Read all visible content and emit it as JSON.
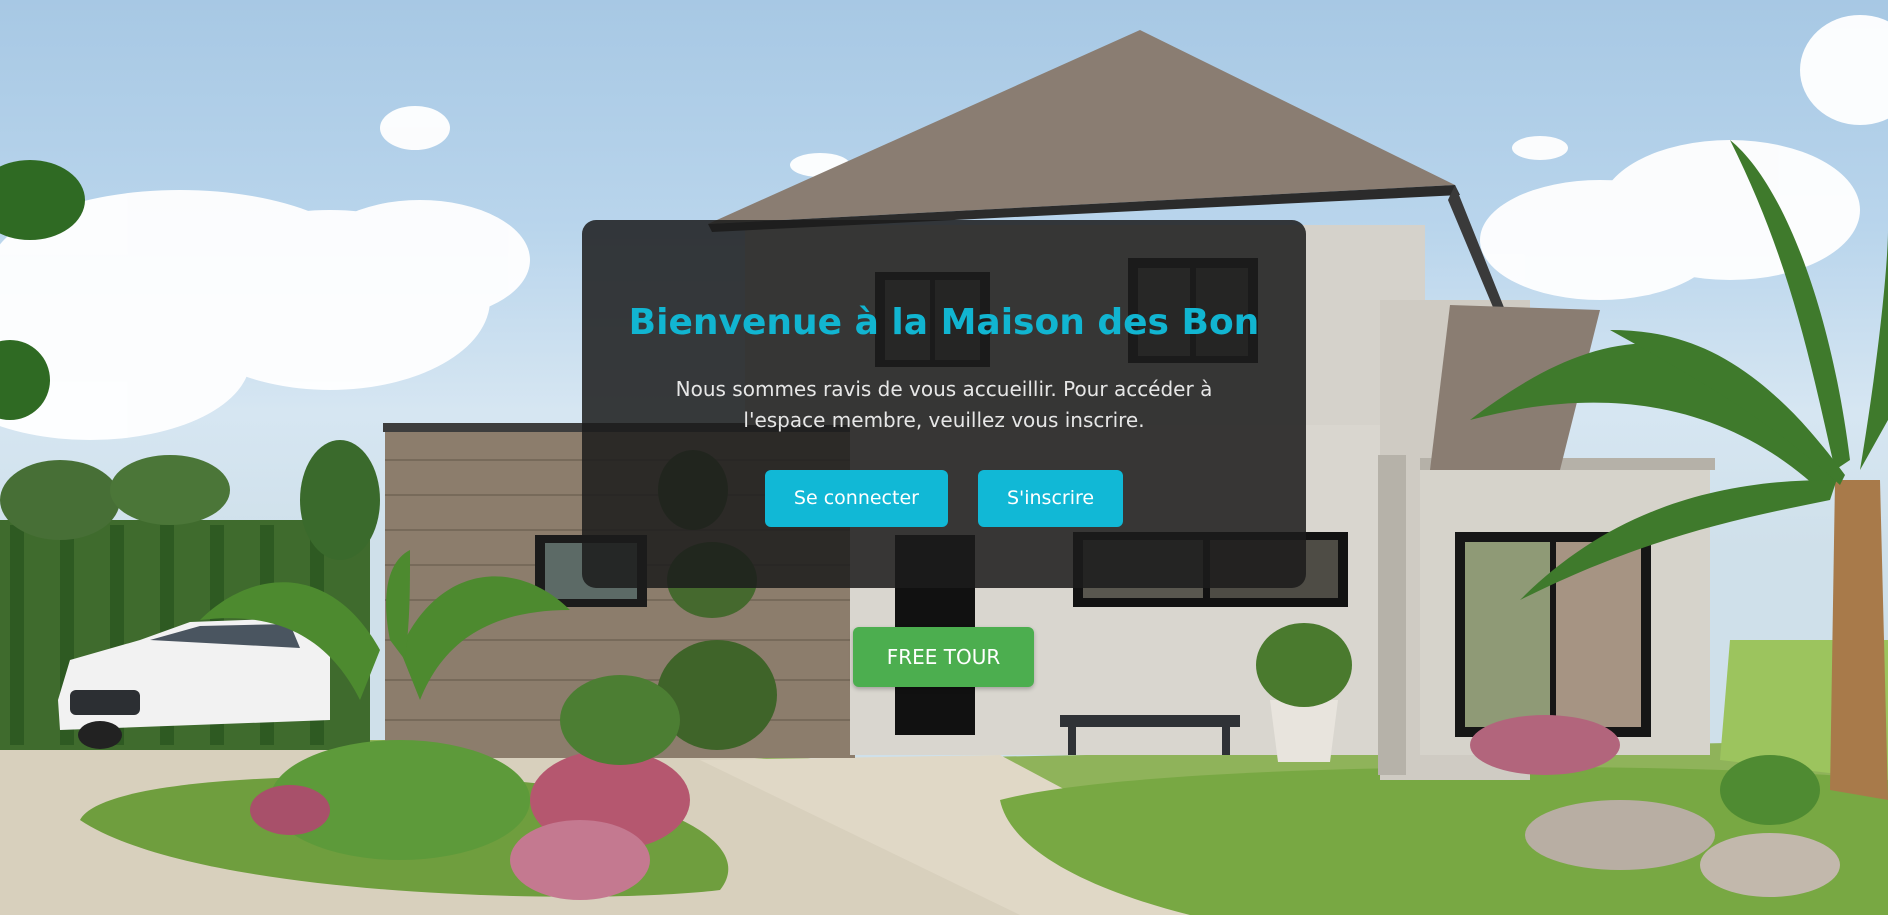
{
  "hero": {
    "title": "Bienvenue à la Maison des Bon",
    "message": "Nous sommes ravis de vous accueillir. Pour accéder à l'espace membre, veuillez vous inscrire."
  },
  "actions": {
    "login_label": "Se connecter",
    "signup_label": "S'inscrire",
    "tour_label": "FREE TOUR"
  },
  "colors": {
    "accent": "#11b5d1",
    "tour_button": "#4cae4f",
    "card_background": "#1c1c1c"
  }
}
